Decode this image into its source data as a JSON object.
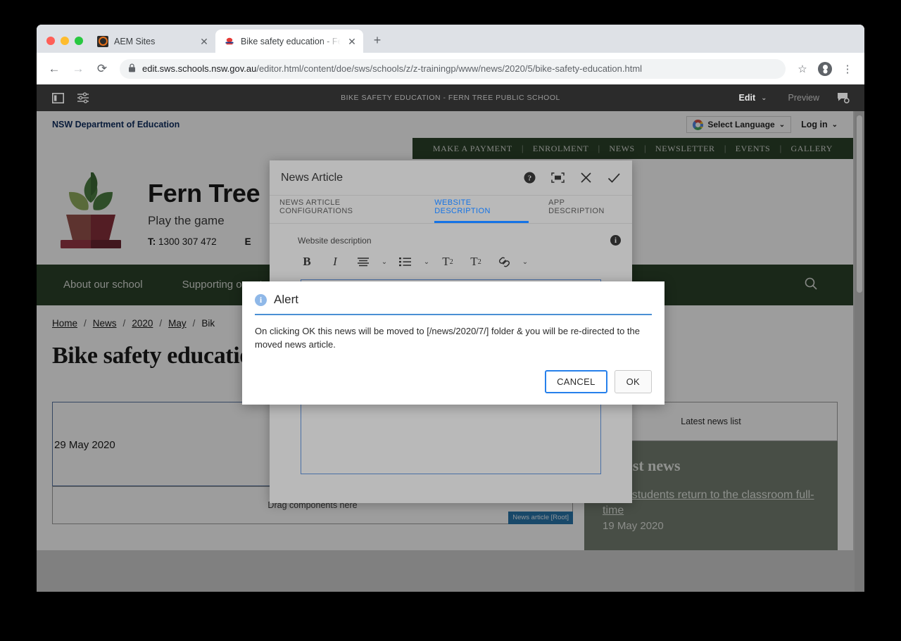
{
  "browser": {
    "tabs": [
      {
        "title": "AEM Sites",
        "favicon": "aem-icon",
        "active": false
      },
      {
        "title": "Bike safety education - Fern Tr",
        "favicon": "school-icon",
        "active": true
      }
    ],
    "newtab_label": "+",
    "close_label": "✕",
    "back_label": "←",
    "forward_label": "→",
    "reload_label": "⟳",
    "lock_icon": "lock-icon",
    "url_host": "edit.sws.schools.nsw.gov.au",
    "url_path": "/editor.html/content/doe/sws/schools/z/z-trainingp/www/news/2020/5/bike-safety-education.html",
    "bookmark_label": "☆",
    "menu_label": "⋮"
  },
  "aem": {
    "sidebar_toggle_icon": "panel-toggle-icon",
    "page_props_icon": "sliders-icon",
    "title": "BIKE SAFETY EDUCATION - FERN TREE PUBLIC SCHOOL",
    "edit_label": "Edit",
    "edit_caret": "⌄",
    "preview_label": "Preview",
    "annotations_icon": "annotations-icon"
  },
  "site": {
    "util": {
      "department": "NSW Department of Education",
      "language_label": "Select Language",
      "language_caret": "⌄",
      "login_label": "Log in",
      "login_caret": "⌄"
    },
    "green_nav": [
      "MAKE A PAYMENT",
      "ENROLMENT",
      "NEWS",
      "NEWSLETTER",
      "EVENTS",
      "GALLERY"
    ],
    "green_sep": "|",
    "header": {
      "school_name": "Fern Tree",
      "motto": "Play the game",
      "phone_prefix": "T:",
      "phone": "1300 307 472",
      "email_prefix": "E"
    },
    "main_nav": [
      "About our school",
      "Supporting our students"
    ],
    "search_icon": "search-icon",
    "breadcrumb": {
      "items": [
        "Home",
        "News",
        "2020",
        "May"
      ],
      "current": "Bik",
      "separator": "/"
    },
    "page_title": "Bike safety education",
    "article": {
      "date": "29 May 2020",
      "dropzone_label": "Drag components here",
      "component_badge": "News article [Root]"
    },
    "sidebar": {
      "placeholder_label": "Latest news list",
      "latest_news_heading": "Latest news",
      "latest_news_link": "NSW students return to the classroom full-time",
      "latest_news_date": "19 May 2020"
    }
  },
  "news_dialog": {
    "title": "News Article",
    "help_icon": "help-icon",
    "fullscreen_icon": "fullscreen-icon",
    "close_icon": "close-icon",
    "confirm_icon": "check-icon",
    "tabs": [
      {
        "label": "NEWS ARTICLE CONFIGURATIONS",
        "active": false
      },
      {
        "label": "WEBSITE DESCRIPTION",
        "active": true
      },
      {
        "label": "APP DESCRIPTION",
        "active": false
      }
    ],
    "field_label": "Website description",
    "field_info_icon": "info-icon",
    "rte": {
      "bold": "B",
      "italic": "I",
      "align_icon": "align-icon",
      "align_caret": "⌄",
      "list_icon": "bullet-list-icon",
      "list_caret": "⌄",
      "subscript": "T",
      "subscript_sub": "2",
      "superscript": "T",
      "superscript_sup": "2",
      "link_icon": "link-icon",
      "link_caret": "⌄"
    },
    "editor_value": ""
  },
  "alert": {
    "icon": "info-icon",
    "title": "Alert",
    "message": "On clicking OK this news will be moved to [/news/2020/7/] folder & you will be re-directed to the moved news article.",
    "cancel_label": "CANCEL",
    "ok_label": "OK"
  },
  "colors": {
    "accent_blue": "#1473e6",
    "school_green": "#1f3b1c",
    "alert_rule": "#4a8fd4",
    "badge_blue": "#1473b5"
  }
}
